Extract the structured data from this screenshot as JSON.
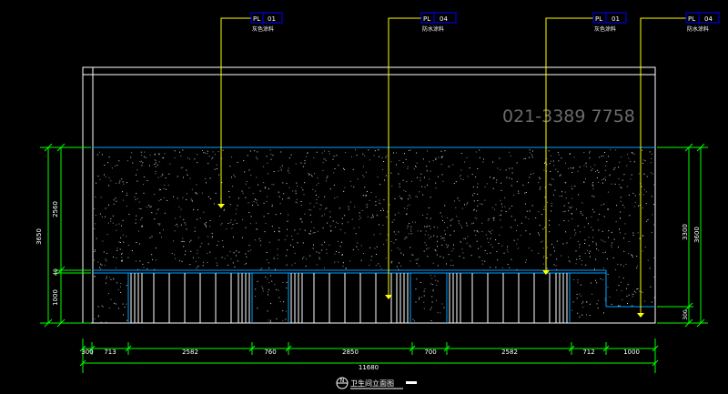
{
  "tags": [
    {
      "code": "PL",
      "num": "01",
      "note": "灰色涂料"
    },
    {
      "code": "PL",
      "num": "04",
      "note": "防水涂料"
    },
    {
      "code": "PL",
      "num": "01",
      "note": "灰色涂料"
    },
    {
      "code": "PL",
      "num": "04",
      "note": "防水涂料"
    }
  ],
  "watermark": "021-3389 7758",
  "dims_bottom": [
    "300",
    "713",
    "2582",
    "760",
    "2850",
    "700",
    "2582",
    "712",
    "1000"
  ],
  "dims_total": "11680",
  "dims_left_outer": "3650",
  "dims_left_inner": [
    "2560",
    "40",
    "1000"
  ],
  "dims_right_outer": "3600",
  "dims_right_inner": [
    "3300",
    "300"
  ],
  "title": {
    "marker": "N",
    "text": "卫生间立面图"
  },
  "colors": {
    "background": "#000000",
    "outline": "#ffffff",
    "cyan": "#00a0ff",
    "leader": "#ffff00",
    "dimension": "#00ff00",
    "tag_box": "#0000ff"
  }
}
